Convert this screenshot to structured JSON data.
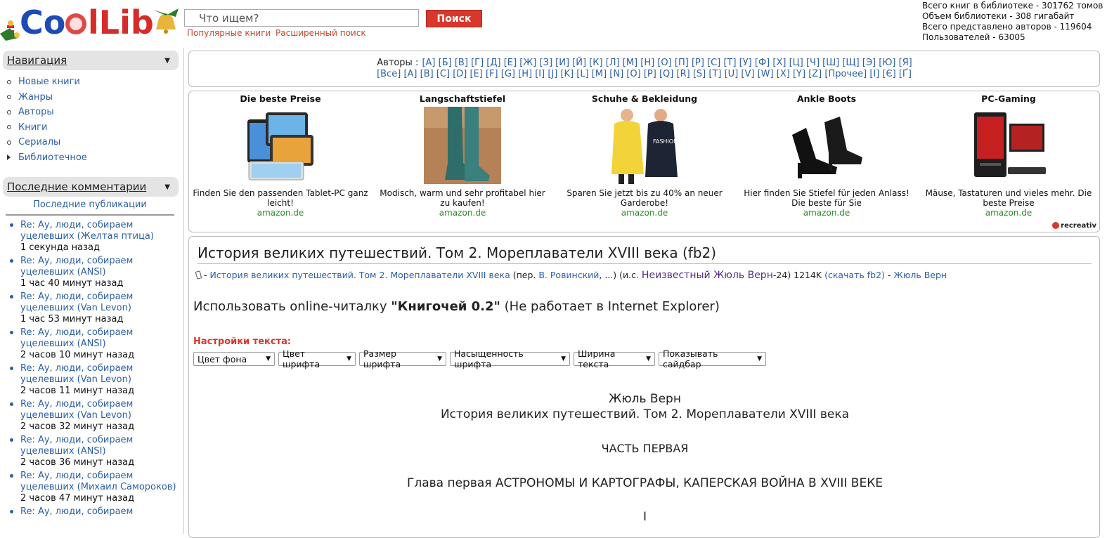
{
  "header": {
    "logo_text": "CoolLib",
    "search_placeholder": "Что ищем?",
    "search_button": "Поиск",
    "popular_link": "Популярные книги",
    "advanced_link": "Расширенный поиск",
    "stats": [
      "Всего книг в библиотеке - 301762 томов",
      "Объем библиотеки - 308 гигабайт",
      "Всего представлено авторов - 119604",
      "Пользователей - 63005"
    ]
  },
  "sidebar": {
    "navigation_title": "Навигация",
    "nav_items": [
      "Новые книги",
      "Жанры",
      "Авторы",
      "Книги",
      "Сериалы",
      "Библиотечное"
    ],
    "comments_title": "Последние комментарии",
    "latest_pubs": "Последние публикации",
    "comments": [
      {
        "text": "Re: Ау, люди, собираем уцелевших (Желтая птица)",
        "time": "1 секунда назад"
      },
      {
        "text": "Re: Ау, люди, собираем уцелевших (ANSI)",
        "time": "1 час 40 минут назад"
      },
      {
        "text": "Re: Ау, люди, собираем уцелевших (Van Levon)",
        "time": "1 час 53 минут назад"
      },
      {
        "text": "Re: Ау, люди, собираем уцелевших (ANSI)",
        "time": "2 часов 10 минут назад"
      },
      {
        "text": "Re: Ау, люди, собираем уцелевших (Van Levon)",
        "time": "2 часов 11 минут назад"
      },
      {
        "text": "Re: Ау, люди, собираем уцелевших (Van Levon)",
        "time": "2 часов 32 минут назад"
      },
      {
        "text": "Re: Ау, люди, собираем уцелевших (ANSI)",
        "time": "2 часов 36 минут назад"
      },
      {
        "text": "Re: Ау, люди, собираем уцелевших (Михаил Самороков)",
        "time": "2 часов 47 минут назад"
      },
      {
        "text": "Re: Ау, люди, собираем",
        "time": ""
      }
    ]
  },
  "authors": {
    "label": "Авторы :",
    "row1": [
      "[А]",
      "[Б]",
      "[В]",
      "[Г]",
      "[Д]",
      "[Е]",
      "[Ж]",
      "[З]",
      "[И]",
      "[Й]",
      "[К]",
      "[Л]",
      "[М]",
      "[Н]",
      "[О]",
      "[П]",
      "[Р]",
      "[С]",
      "[Т]",
      "[У]",
      "[Ф]",
      "[Х]",
      "[Ц]",
      "[Ч]",
      "[Ш]",
      "[Щ]",
      "[Э]",
      "[Ю]",
      "[Я]"
    ],
    "row2": [
      "[Все]",
      "[A]",
      "[B]",
      "[C]",
      "[D]",
      "[E]",
      "[F]",
      "[G]",
      "[H]",
      "[I]",
      "[J]",
      "[K]",
      "[L]",
      "[M]",
      "[N]",
      "[O]",
      "[P]",
      "[Q]",
      "[R]",
      "[S]",
      "[T]",
      "[U]",
      "[V]",
      "[W]",
      "[X]",
      "[Y]",
      "[Z]",
      "[Прочее]",
      "[І]",
      "[Є]",
      "[Ґ]"
    ]
  },
  "ads": [
    {
      "title": "Die beste Preise",
      "desc": "Finden Sie den passenden Tablet-PC ganz leicht!",
      "src": "amazon.de"
    },
    {
      "title": "Langschaftstiefel",
      "desc": "Modisch, warm und sehr profitabel hier zu kaufen!",
      "src": "amazon.de"
    },
    {
      "title": "Schuhe & Bekleidung",
      "desc": "Sparen Sie jetzt bis zu 40% an neuer Garderobe!",
      "src": "amazon.de"
    },
    {
      "title": "Ankle Boots",
      "desc": "Hier finden Sie Stiefel für jeden Anlass! Die beste für Sie",
      "src": "amazon.de"
    },
    {
      "title": "PC-Gaming",
      "desc": "Mäuse, Tastaturen und vieles mehr. Die beste Preise",
      "src": "amazon.de"
    }
  ],
  "ads_brand": "recreativ",
  "book": {
    "title": "История великих путешествий. Том 2. Мореплаватели XVIII века (fb2)",
    "line_prefix": " - ",
    "book_link": "История великих путешествий. Том 2. Мореплаватели XVIII века",
    "transl_open": " (пер. ",
    "translator": "В. Ровинский",
    "transl_close": ", ...) (и.с. ",
    "series": "Неизвестный Жюль Верн",
    "series_num": "-24) 1214K ",
    "download": "(скачать fb2)",
    "dash": " - ",
    "author": "Жюль Верн"
  },
  "reader": {
    "prefix": "Использовать online-читалку ",
    "name": "\"Книгочей 0.2\"",
    "suffix": " (Не работает в Internet Explorer)"
  },
  "settings": {
    "label": "Настройки текста:",
    "selects": [
      "Цвет фона",
      "Цвет шрифта",
      "Размер шрифта",
      "Насыщенность шрифта",
      "Ширина текста",
      "Показывать сайдбар"
    ]
  },
  "text": {
    "author": "Жюль Верн",
    "title": "История великих путешествий. Том 2. Мореплаватели XVIII века",
    "part": "ЧАСТЬ ПЕРВАЯ",
    "chapter": "Глава первая  АСТРОНОМЫ И КАРТОГРАФЫ, КАПЕРСКАЯ ВОЙНА В XVIII ВЕКЕ",
    "section": "I"
  }
}
